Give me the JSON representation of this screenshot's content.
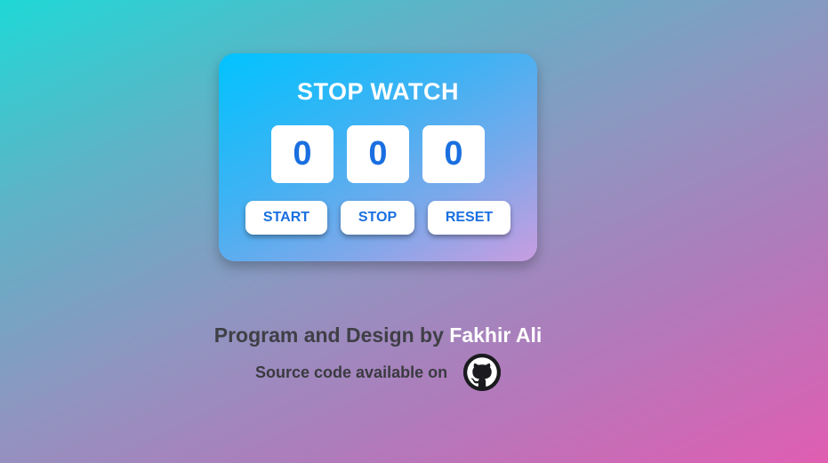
{
  "stopwatch": {
    "title": "STOP WATCH",
    "digits": [
      "0",
      "0",
      "0"
    ],
    "buttons": {
      "start": "START",
      "stop": "STOP",
      "reset": "RESET"
    }
  },
  "footer": {
    "credit_prefix": "Program and Design by ",
    "author": "Fakhir Ali",
    "source_text": "Source code available on",
    "source_icon": "github-icon"
  },
  "colors": {
    "digit_text": "#1a6fe0",
    "author": "#ffffff",
    "credit_text": "#3f3f46"
  }
}
